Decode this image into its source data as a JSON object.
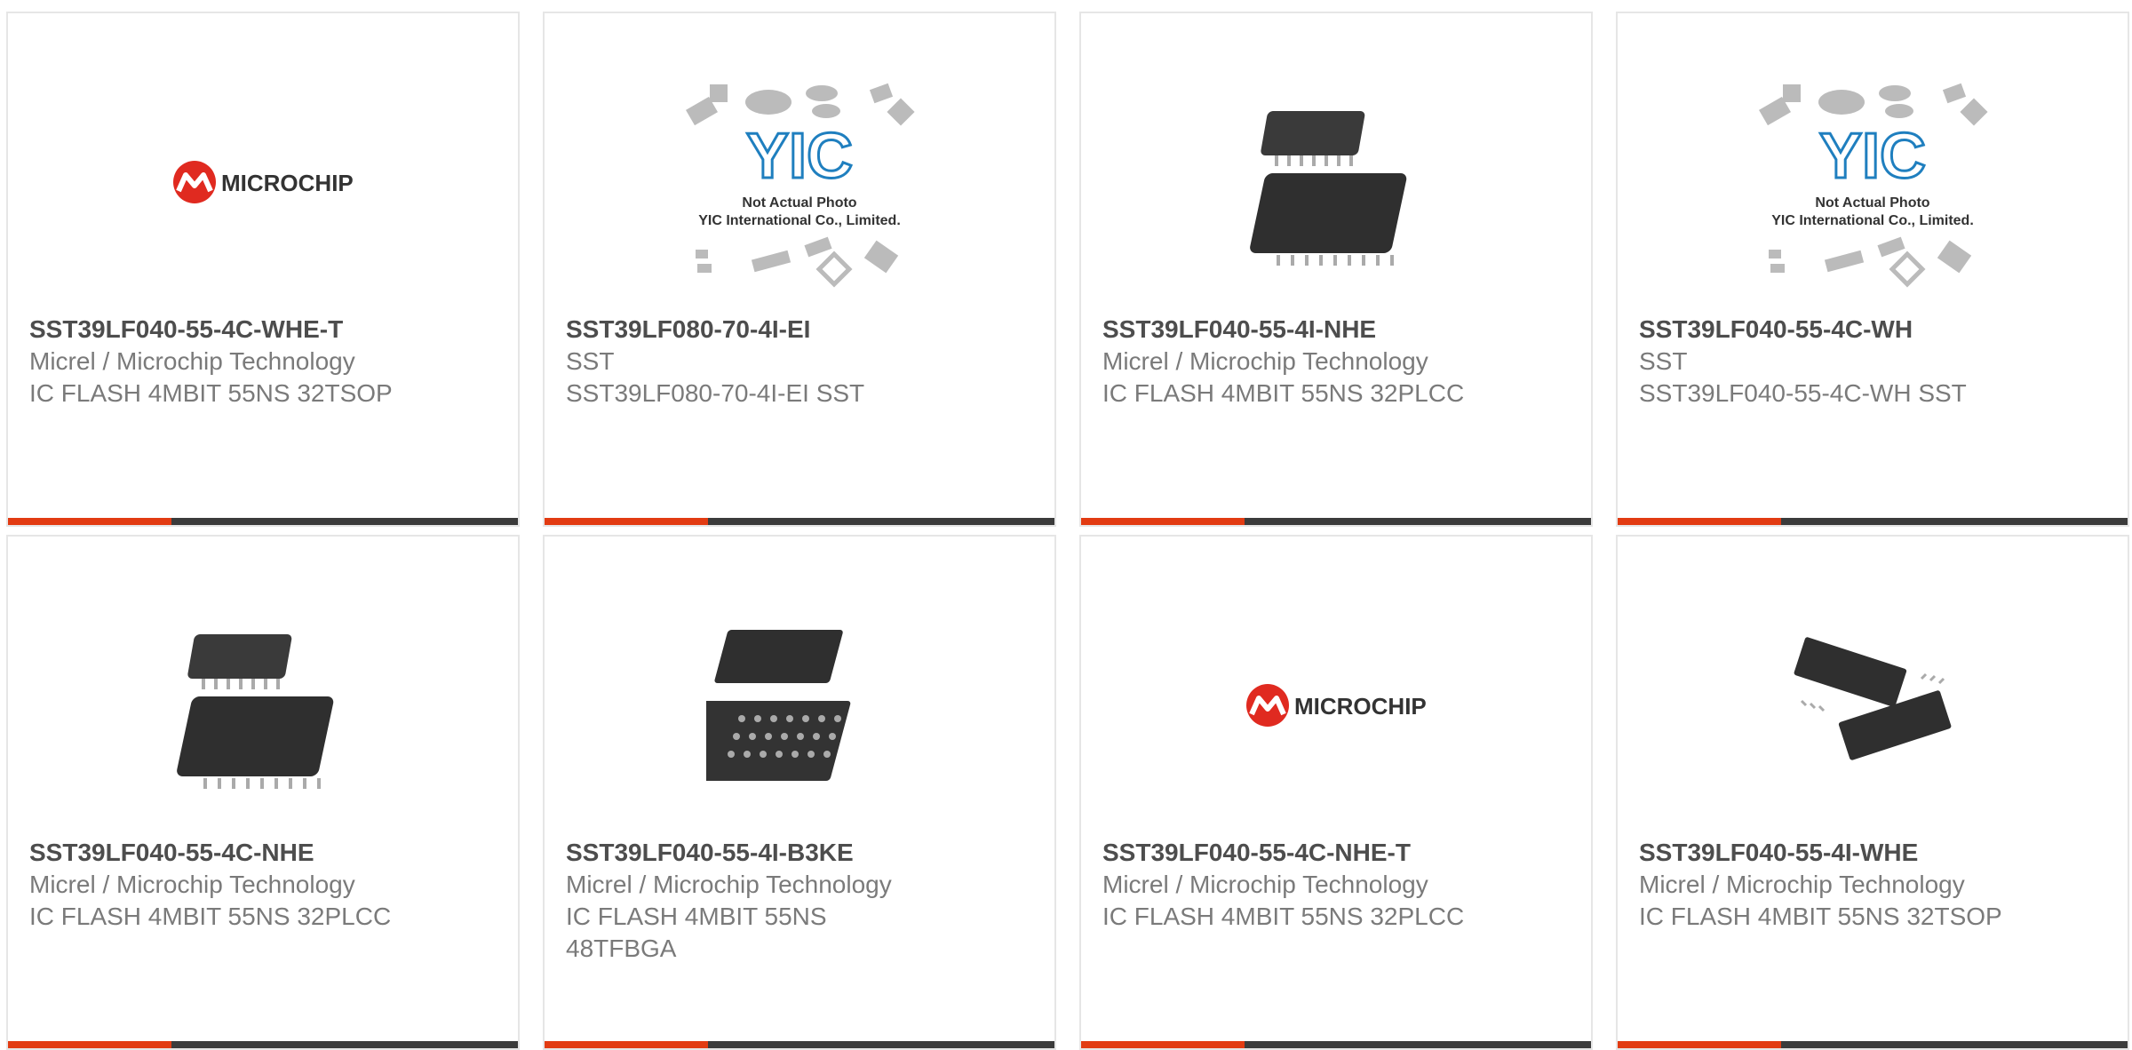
{
  "products": [
    {
      "part": "SST39LF040-55-4C-WHE-T",
      "manufacturer": "Micrel / Microchip Technology",
      "description": "IC FLASH 4MBIT 55NS 32TSOP",
      "image": "microchip-logo"
    },
    {
      "part": "SST39LF080-70-4I-EI",
      "manufacturer": "SST",
      "description": "SST39LF080-70-4I-EI SST",
      "image": "yic-placeholder"
    },
    {
      "part": "SST39LF040-55-4I-NHE",
      "manufacturer": "Micrel / Microchip Technology",
      "description": "IC FLASH 4MBIT 55NS 32PLCC",
      "image": "plcc-chip"
    },
    {
      "part": "SST39LF040-55-4C-WH",
      "manufacturer": "SST",
      "description": "SST39LF040-55-4C-WH SST",
      "image": "yic-placeholder"
    },
    {
      "part": "SST39LF040-55-4C-NHE",
      "manufacturer": "Micrel / Microchip Technology",
      "description": "IC FLASH 4MBIT 55NS 32PLCC",
      "image": "plcc-chip"
    },
    {
      "part": "SST39LF040-55-4I-B3KE",
      "manufacturer": "Micrel / Microchip Technology",
      "description": "IC FLASH 4MBIT 55NS 48TFBGA",
      "image": "bga-chip"
    },
    {
      "part": "SST39LF040-55-4C-NHE-T",
      "manufacturer": "Micrel / Microchip Technology",
      "description": "IC FLASH 4MBIT 55NS 32PLCC",
      "image": "microchip-logo"
    },
    {
      "part": "SST39LF040-55-4I-WHE",
      "manufacturer": "Micrel / Microchip Technology",
      "description": "IC FLASH 4MBIT 55NS 32TSOP",
      "image": "tsop-chip"
    }
  ],
  "placeholder": {
    "brand": "YIC",
    "line1": "Not Actual Photo",
    "line2": "YIC International Co., Limited."
  },
  "logo": {
    "text": "MICROCHIP"
  },
  "colors": {
    "accent": "#e23b12",
    "bar": "#3b3b3b",
    "part_text": "#4d4d4d",
    "sub_text": "#7a7a7a"
  }
}
